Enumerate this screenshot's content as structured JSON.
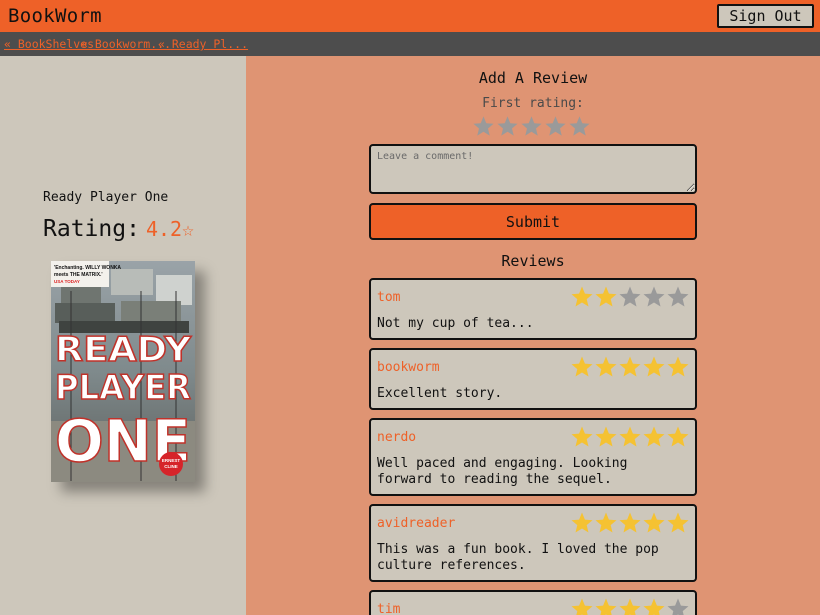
{
  "header": {
    "app_title": "BookWorm",
    "signout_label": "Sign Out"
  },
  "breadcrumbs": [
    {
      "label": "« BookShelves"
    },
    {
      "label": "« Bookworm..."
    },
    {
      "label": "« Ready Pl..."
    }
  ],
  "book": {
    "title": "Ready Player One",
    "rating_label": "Rating:",
    "rating_value": "4.2☆",
    "cover": {
      "quote_line1": "'Enchanting. WILLY WONKA",
      "quote_line2": "meets THE MATRIX.'",
      "quote_source": "USA TODAY",
      "title_lines": [
        "READY",
        "PLAYER",
        "ONE"
      ],
      "author_line1": "ERNEST",
      "author_line2": "CLINE"
    }
  },
  "review_form": {
    "title": "Add A Review",
    "first_rating_label": "First rating:",
    "star_count": 5,
    "selected_rating": 0,
    "comment_placeholder": "Leave a comment!",
    "comment_value": "",
    "submit_label": "Submit"
  },
  "reviews_title": "Reviews",
  "reviews": [
    {
      "user": "tom",
      "rating": 2,
      "text": "Not my cup of tea..."
    },
    {
      "user": "bookworm",
      "rating": 5,
      "text": "Excellent story."
    },
    {
      "user": "nerdo",
      "rating": 5,
      "text": "Well paced and engaging. Looking forward to reading the sequel."
    },
    {
      "user": "avidreader",
      "rating": 5,
      "text": "This was a fun book. I loved the pop culture references."
    },
    {
      "user": "tim",
      "rating": 4,
      "text": ""
    }
  ],
  "colors": {
    "accent": "#ee6128",
    "panel": "#cdc7bb",
    "right_bg": "#df9473",
    "star_filled": "#f5c232",
    "star_empty": "#9a9a9a"
  }
}
